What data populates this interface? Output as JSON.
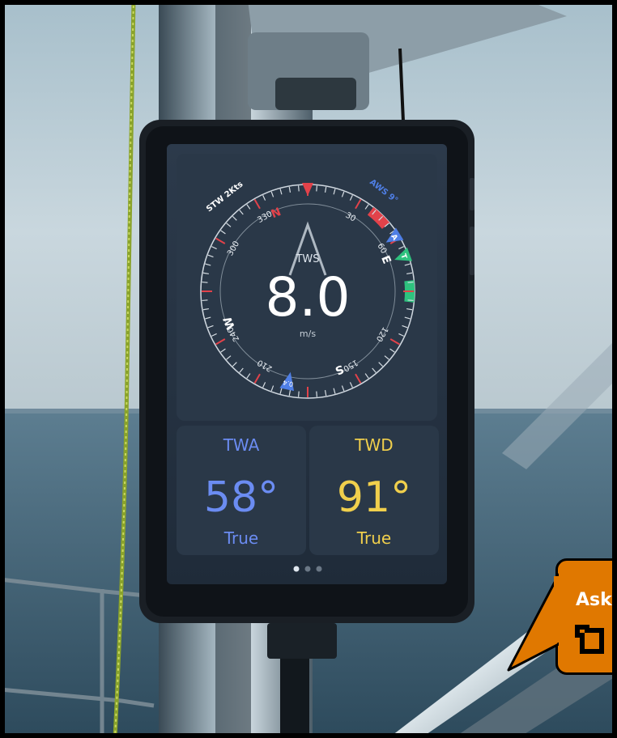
{
  "device": {
    "compass": {
      "top_left_label": "STW 2Kts",
      "top_right_label": "AWS 9°",
      "center_label": "TWS",
      "center_value": "8.0",
      "center_unit": "m/s",
      "cardinals": [
        "N",
        "E",
        "S",
        "W"
      ],
      "degree_marks": [
        "30",
        "60",
        "120",
        "150",
        "210",
        "240",
        "300",
        "330"
      ],
      "a_marker": "A",
      "t_marker": "T",
      "bottom_marker_value": "0.4",
      "colors": {
        "red": "#e2424a",
        "green": "#2ec27e",
        "blue": "#4f7fe6",
        "accent_blue": "#4f7fe6"
      }
    },
    "tiles": [
      {
        "title": "TWA",
        "value": "58°",
        "subtitle": "True",
        "color": "#6b8cf2"
      },
      {
        "title": "TWD",
        "value": "91°",
        "subtitle": "True",
        "color": "#f0cf4c"
      }
    ],
    "pager": {
      "dots": 3,
      "active": 0
    }
  },
  "ask_tooltip": {
    "label": "Ask",
    "icon": "bracket-icon",
    "color": "#e07800"
  }
}
